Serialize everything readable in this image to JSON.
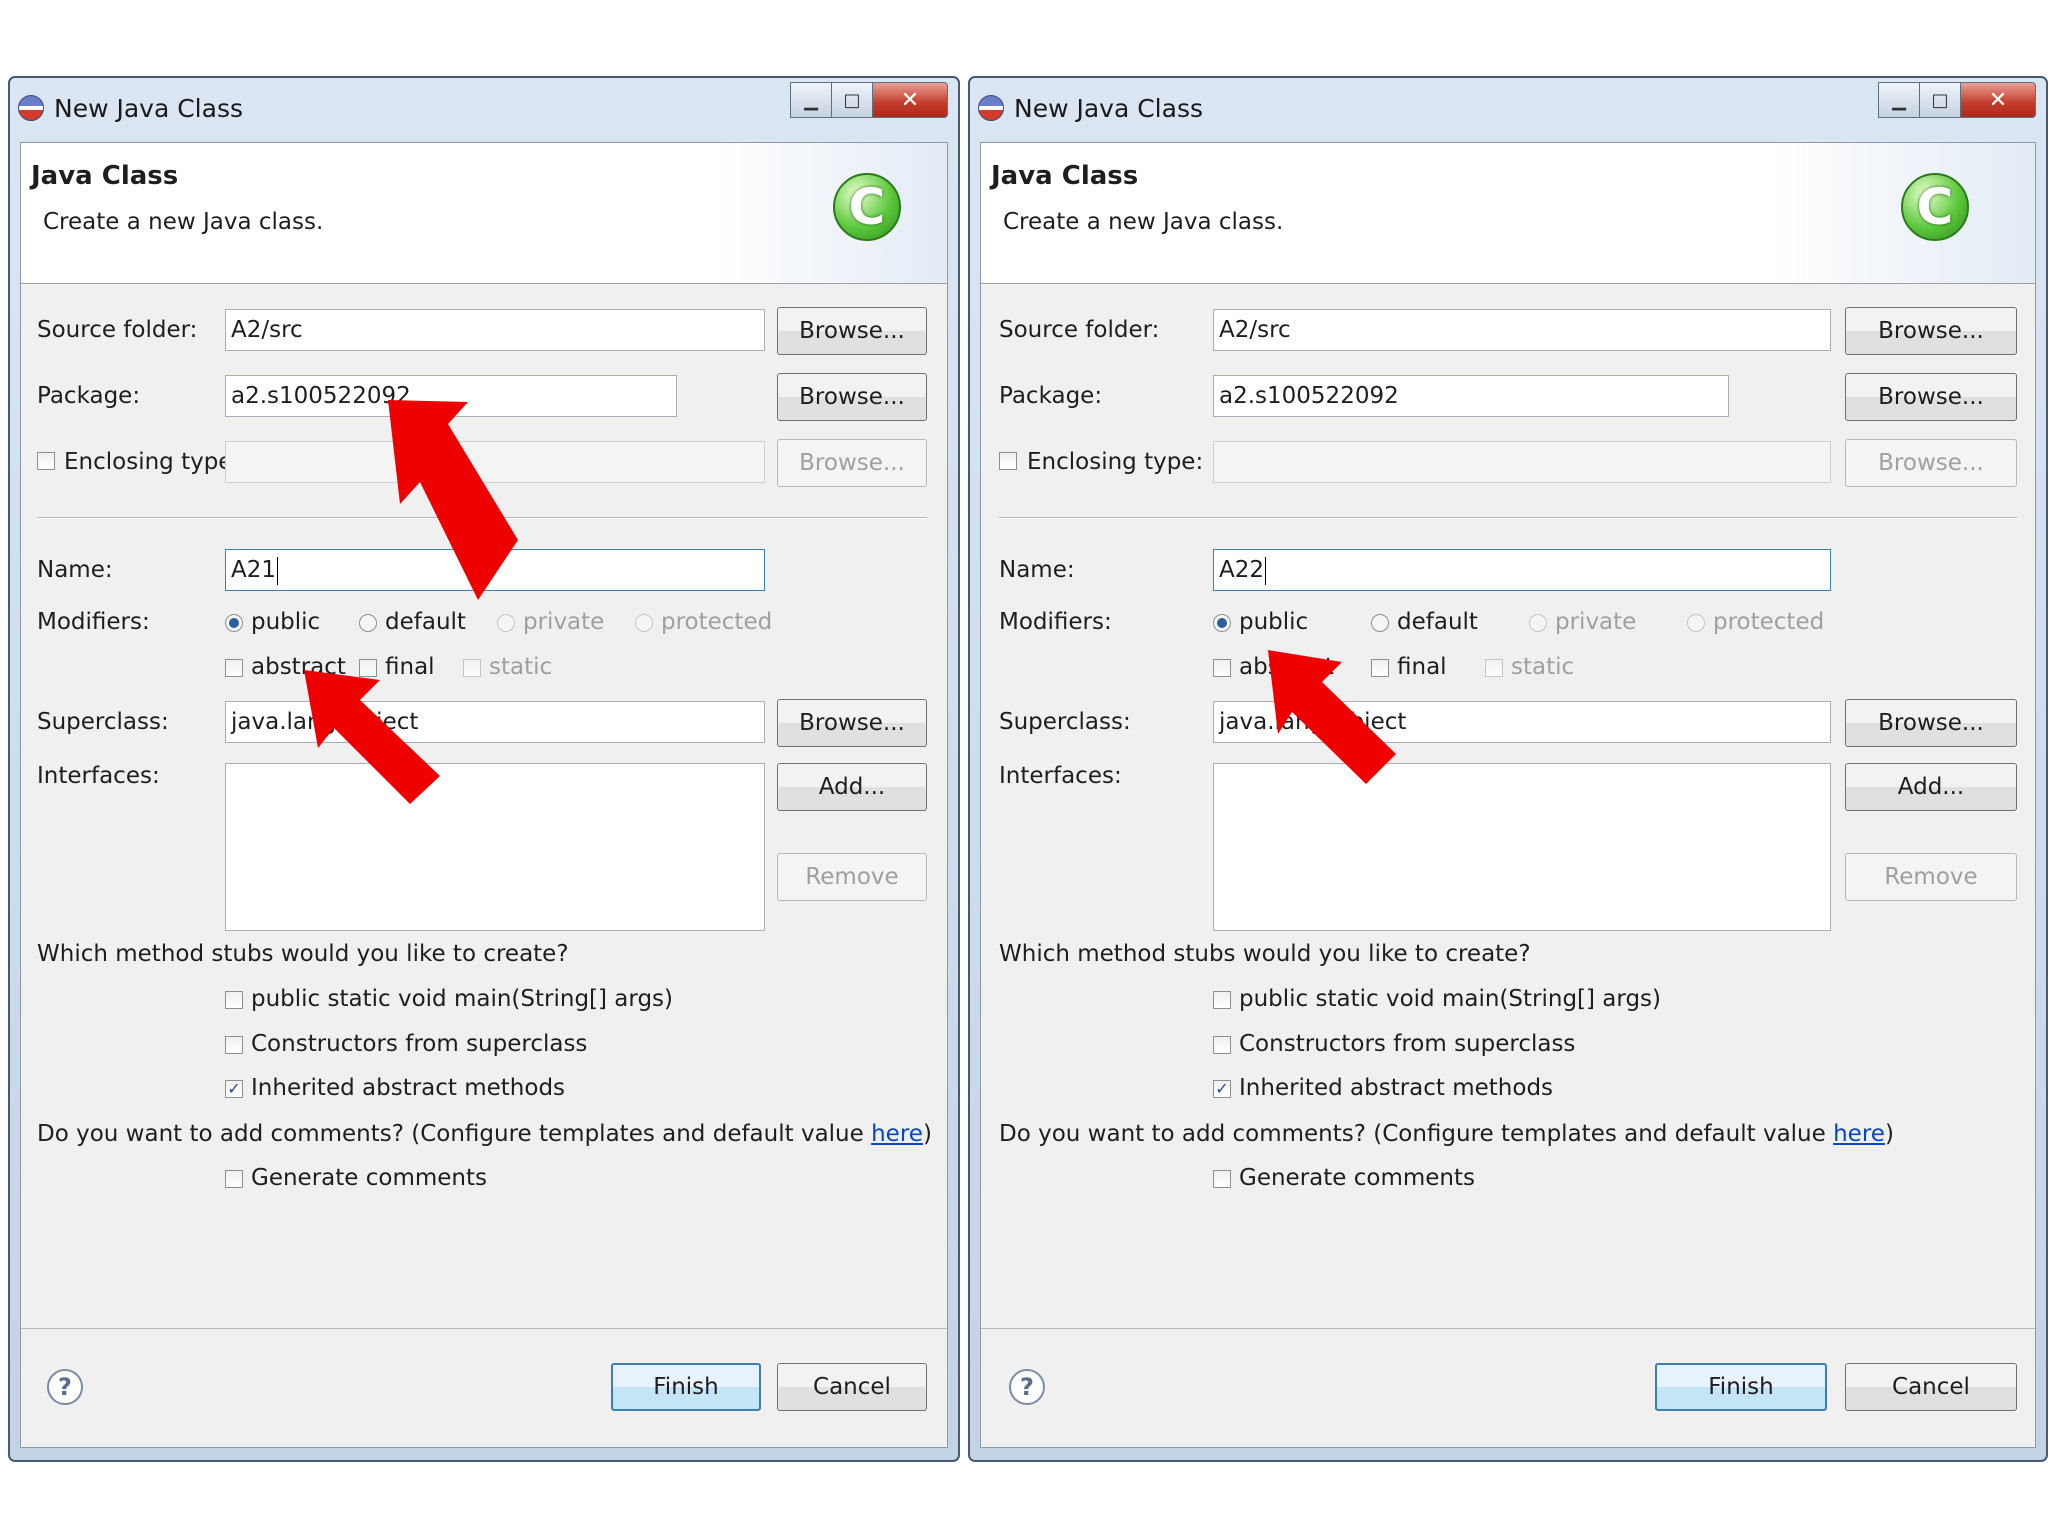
{
  "dialogs": [
    {
      "window_title": "New Java Class",
      "banner_title": "Java Class",
      "banner_subtitle": "Create a new Java class.",
      "source_folder": {
        "label": "Source folder:",
        "value": "A2/src",
        "button": "Browse..."
      },
      "package": {
        "label": "Package:",
        "value": "a2.s100522092",
        "button": "Browse..."
      },
      "enclosing_type": {
        "label": "Enclosing type:",
        "value": "",
        "button": "Browse...",
        "checked": false
      },
      "name": {
        "label": "Name:",
        "value": "A21"
      },
      "modifiers": {
        "label": "Modifiers:",
        "access": [
          "public",
          "default",
          "private",
          "protected"
        ],
        "selected": "public",
        "other": [
          "abstract",
          "final",
          "static"
        ]
      },
      "superclass": {
        "label": "Superclass:",
        "value": "java.lang.Object",
        "button": "Browse..."
      },
      "interfaces": {
        "label": "Interfaces:",
        "add_button": "Add...",
        "remove_button": "Remove"
      },
      "stubs_question": "Which method stubs would you like to create?",
      "stubs": [
        {
          "label": "public static void main(String[] args)",
          "checked": false
        },
        {
          "label": "Constructors from superclass",
          "checked": false
        },
        {
          "label": "Inherited abstract methods",
          "checked": true
        }
      ],
      "comments_question": "Do you want to add comments? (Configure templates and default value ",
      "comments_link": "here",
      "comments_close": ")",
      "generate_comments": {
        "label": "Generate comments",
        "checked": false
      },
      "finish_button": "Finish",
      "cancel_button": "Cancel"
    },
    {
      "window_title": "New Java Class",
      "banner_title": "Java Class",
      "banner_subtitle": "Create a new Java class.",
      "source_folder": {
        "label": "Source folder:",
        "value": "A2/src",
        "button": "Browse..."
      },
      "package": {
        "label": "Package:",
        "value": "a2.s100522092",
        "button": "Browse..."
      },
      "enclosing_type": {
        "label": "Enclosing type:",
        "value": "",
        "button": "Browse...",
        "checked": false
      },
      "name": {
        "label": "Name:",
        "value": "A22"
      },
      "modifiers": {
        "label": "Modifiers:",
        "access": [
          "public",
          "default",
          "private",
          "protected"
        ],
        "selected": "public",
        "other": [
          "abstract",
          "final",
          "static"
        ]
      },
      "superclass": {
        "label": "Superclass:",
        "value": "java.lang.Object",
        "button": "Browse..."
      },
      "interfaces": {
        "label": "Interfaces:",
        "add_button": "Add...",
        "remove_button": "Remove"
      },
      "stubs_question": "Which method stubs would you like to create?",
      "stubs": [
        {
          "label": "public static void main(String[] args)",
          "checked": false
        },
        {
          "label": "Constructors from superclass",
          "checked": false
        },
        {
          "label": "Inherited abstract methods",
          "checked": true
        }
      ],
      "comments_question": "Do you want to add comments? (Configure templates and default value ",
      "comments_link": "here",
      "comments_close": ")",
      "generate_comments": {
        "label": "Generate comments",
        "checked": false
      },
      "finish_button": "Finish",
      "cancel_button": "Cancel"
    }
  ],
  "icons": {
    "window": "eclipse-icon",
    "banner": "java-class-icon",
    "help": "help-icon",
    "annotation": "red-arrow"
  },
  "colors": {
    "annotation_arrow": "#ee0000",
    "link": "#0645c8",
    "default_button_border": "#3c7fb1"
  }
}
